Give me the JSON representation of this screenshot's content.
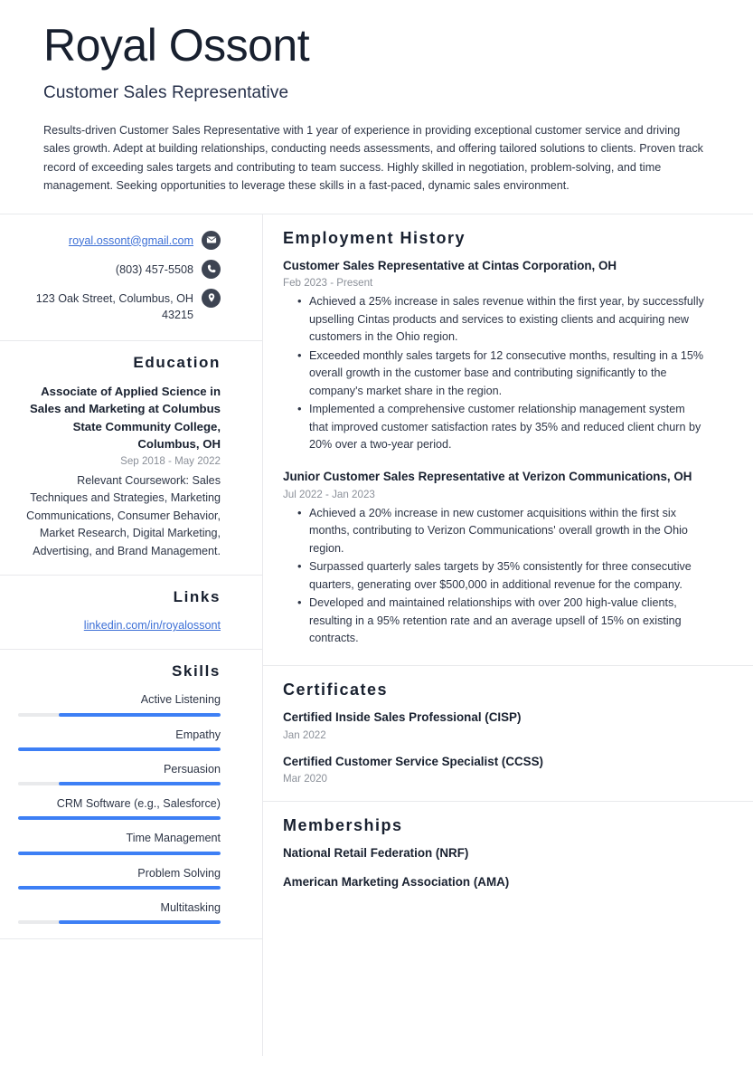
{
  "header": {
    "name": "Royal Ossont",
    "job_title": "Customer Sales Representative",
    "summary": "Results-driven Customer Sales Representative with 1 year of experience in providing exceptional customer service and driving sales growth. Adept at building relationships, conducting needs assessments, and offering tailored solutions to clients. Proven track record of exceeding sales targets and contributing to team success. Highly skilled in negotiation, problem-solving, and time management. Seeking opportunities to leverage these skills in a fast-paced, dynamic sales environment."
  },
  "contact": {
    "items": [
      {
        "text": "royal.ossont@gmail.com",
        "icon": "envelope-icon",
        "is_link": true
      },
      {
        "text": "(803) 457-5508",
        "icon": "phone-icon",
        "is_link": false
      },
      {
        "text": "123 Oak Street, Columbus, OH 43215",
        "icon": "location-pin-icon",
        "is_link": false
      }
    ]
  },
  "education": {
    "heading": "Education",
    "degree": "Associate of Applied Science in Sales and Marketing at Columbus State Community College, Columbus, OH",
    "dates": "Sep 2018 - May 2022",
    "description": "Relevant Coursework: Sales Techniques and Strategies, Marketing Communications, Consumer Behavior, Market Research, Digital Marketing, Advertising, and Brand Management."
  },
  "links": {
    "heading": "Links",
    "items": [
      {
        "label": "linkedin.com/in/royalossont"
      }
    ]
  },
  "skills": {
    "heading": "Skills",
    "items": [
      {
        "name": "Active Listening",
        "level": 80
      },
      {
        "name": "Empathy",
        "level": 100
      },
      {
        "name": "Persuasion",
        "level": 80
      },
      {
        "name": "CRM Software (e.g., Salesforce)",
        "level": 100
      },
      {
        "name": "Time Management",
        "level": 100
      },
      {
        "name": "Problem Solving",
        "level": 100
      },
      {
        "name": "Multitasking",
        "level": 80
      }
    ]
  },
  "employment": {
    "heading": "Employment History",
    "entries": [
      {
        "title": "Customer Sales Representative at Cintas Corporation, OH",
        "dates": "Feb 2023 - Present",
        "bullets": [
          "Achieved a 25% increase in sales revenue within the first year, by successfully upselling Cintas products and services to existing clients and acquiring new customers in the Ohio region.",
          "Exceeded monthly sales targets for 12 consecutive months, resulting in a 15% overall growth in the customer base and contributing significantly to the company's market share in the region.",
          "Implemented a comprehensive customer relationship management system that improved customer satisfaction rates by 35% and reduced client churn by 20% over a two-year period."
        ]
      },
      {
        "title": "Junior Customer Sales Representative at Verizon Communications, OH",
        "dates": "Jul 2022 - Jan 2023",
        "bullets": [
          "Achieved a 20% increase in new customer acquisitions within the first six months, contributing to Verizon Communications' overall growth in the Ohio region.",
          "Surpassed quarterly sales targets by 35% consistently for three consecutive quarters, generating over $500,000 in additional revenue for the company.",
          "Developed and maintained relationships with over 200 high-value clients, resulting in a 95% retention rate and an average upsell of 15% on existing contracts."
        ]
      }
    ]
  },
  "certificates": {
    "heading": "Certificates",
    "entries": [
      {
        "title": "Certified Inside Sales Professional (CISP)",
        "date": "Jan 2022"
      },
      {
        "title": "Certified Customer Service Specialist (CCSS)",
        "date": "Mar 2020"
      }
    ]
  },
  "memberships": {
    "heading": "Memberships",
    "items": [
      {
        "label": "National Retail Federation (NRF)"
      },
      {
        "label": "American Marketing Association (AMA)"
      }
    ]
  },
  "colors": {
    "accent_blue": "#3d7ff5",
    "link_blue": "#3c6fd6",
    "icon_dark": "#3d4452",
    "text_dark": "#18202f",
    "text_muted": "#8b9099",
    "divider": "#e8e9ec",
    "track_gray": "#e9eaec"
  }
}
